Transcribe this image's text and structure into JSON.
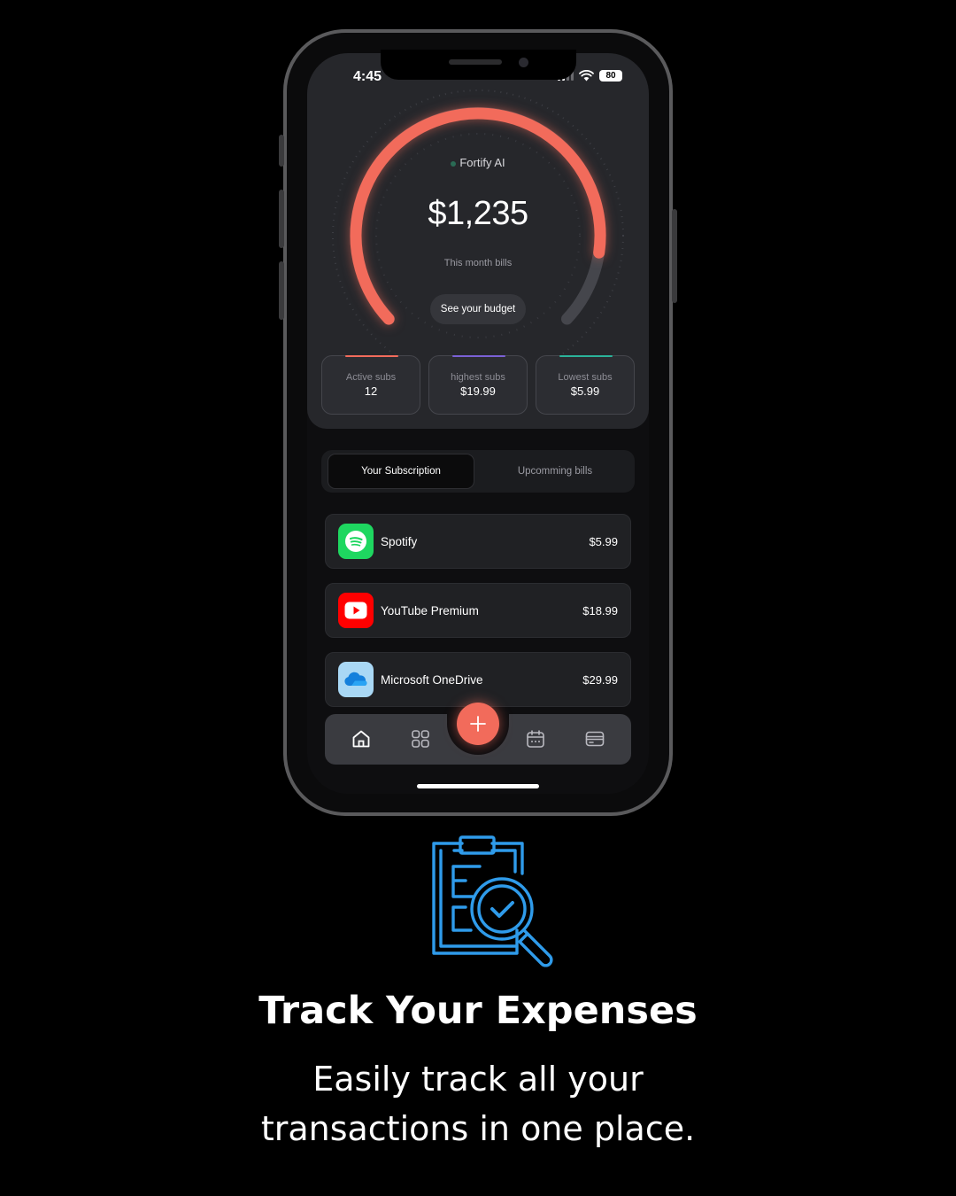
{
  "status_bar": {
    "time": "4:45",
    "battery": "80"
  },
  "gauge": {
    "brand": "Fortify AI",
    "amount": "$1,235",
    "subtitle": "This month bills",
    "budget_button": "See your budget",
    "arc_color": "#f26b5b"
  },
  "stats": [
    {
      "label": "Active subs",
      "value": "12",
      "accent": "#f26b5b"
    },
    {
      "label": "highest subs",
      "value": "$19.99",
      "accent": "#7b61d6"
    },
    {
      "label": "Lowest subs",
      "value": "$5.99",
      "accent": "#2bb39a"
    }
  ],
  "tabs": {
    "active": "Your Subscription",
    "inactive": "Upcomming bills"
  },
  "subscriptions": [
    {
      "name": "Spotify",
      "price": "$5.99",
      "icon": "spotify-icon",
      "color": "#1ed760"
    },
    {
      "name": "YouTube Premium",
      "price": "$18.99",
      "icon": "youtube-icon",
      "color": "#ff0000"
    },
    {
      "name": "Microsoft OneDrive",
      "price": "$29.99",
      "icon": "onedrive-icon",
      "color": "#a9d8f5"
    }
  ],
  "nav": {
    "items": [
      "home-icon",
      "apps-grid-icon",
      "add-icon",
      "calendar-icon",
      "card-icon"
    ],
    "accent": "#f26b5b"
  },
  "promo": {
    "headline": "Track Your Expenses",
    "line1": "Easily track all your",
    "line2": "transactions in one place.",
    "icon": "clipboard-search-icon",
    "icon_color": "#2f9bea"
  }
}
